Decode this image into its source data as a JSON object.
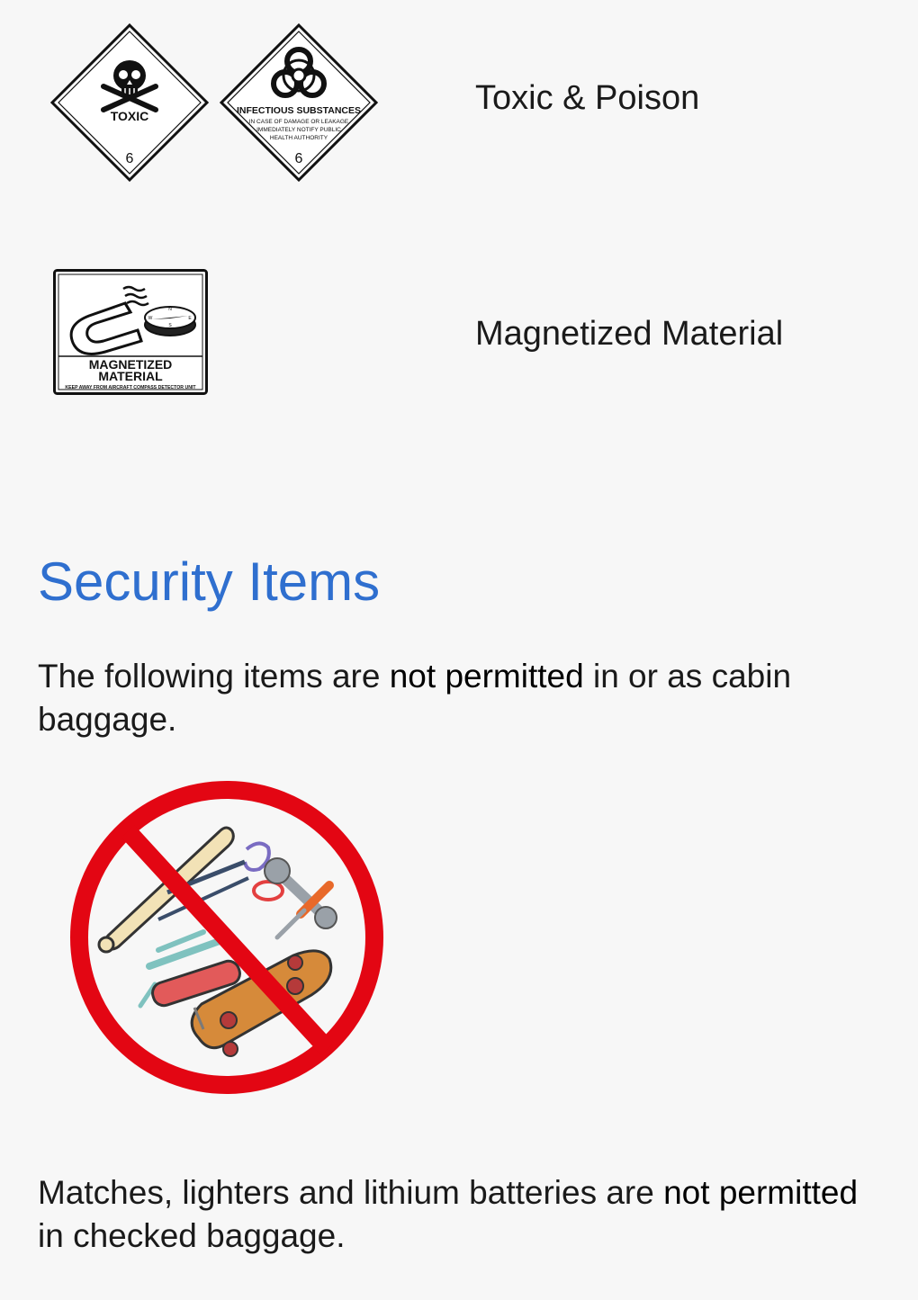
{
  "hazards": [
    {
      "label": "Toxic & Poison",
      "signs": [
        {
          "icon": "skull-crossbones-icon",
          "title": "TOXIC",
          "class_number": "6"
        },
        {
          "icon": "biohazard-icon",
          "title": "INFECTIOUS SUBSTANCES",
          "lines": [
            "IN CASE OF DAMAGE OR LEAKAGE",
            "IMMEDIATELY NOTIFY PUBLIC",
            "HEALTH AUTHORITY"
          ],
          "class_number": "6"
        }
      ]
    },
    {
      "label": "Magnetized Material",
      "signs": [
        {
          "icon": "magnet-compass-icon",
          "title_line1": "MAGNETIZED",
          "title_line2": "MATERIAL",
          "subtitle": "KEEP AWAY FROM AIRCRAFT COMPASS DETECTOR UNIT",
          "compass": [
            "N",
            "E",
            "S",
            "W"
          ]
        }
      ]
    }
  ],
  "security": {
    "heading": "Security Items",
    "para1_part1": "The following items are ",
    "para1_emph": "not permitted",
    "para1_part2": " in or as cabin baggage.",
    "prohibited_icon": "prohibited-tools-icon",
    "para2_part1": "Matches, lighters and lithium batteries are ",
    "para2_emph": "not permitted",
    "para2_part2": " in checked baggage."
  },
  "colors": {
    "heading": "#2f6fcf",
    "prohibition_red": "#e30613",
    "background": "#f7f7f7"
  }
}
